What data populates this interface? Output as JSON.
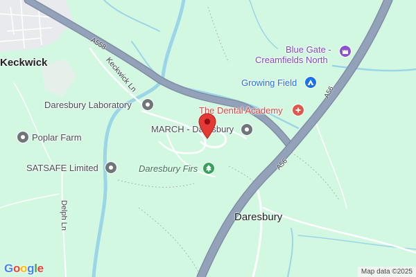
{
  "map": {
    "places": {
      "keckwick": "Keckwick",
      "daresbury": "Daresbury"
    },
    "pois": {
      "daresbury_laboratory": "Daresbury Laboratory",
      "march_daresbury": "MARCH - Daresbury",
      "poplar_farm": "Poplar Farm",
      "satsafe": "SATSAFE Limited",
      "daresbury_firs": "Daresbury Firs",
      "blue_gate_line1": "Blue Gate -",
      "blue_gate_line2": "Creamfields North",
      "growing_field": "Growing Field",
      "dental_academy": "The Dental Academy"
    },
    "roads": {
      "a558": "A558",
      "a56_north": "A56",
      "a56_south": "A56",
      "keckwick_ln": "Keckwick Ln",
      "delph_ln": "Delph Ln"
    },
    "logo": {
      "g1": "G",
      "o1": "o",
      "o2": "o",
      "g2": "g",
      "l": "l",
      "e": "e"
    },
    "attribution": "Map data ©2025",
    "colors": {
      "land": "#d3f8e2",
      "water": "#9ad5e8",
      "major_road": "#8e9bb0",
      "minor_road": "#ffffff",
      "marker": "#e53935"
    },
    "icons": {
      "marker": "red-pin-marker",
      "poi_generic": "circle-dot-icon",
      "blue_gate": "castle-icon",
      "growing_field": "tent-icon",
      "dental": "medical-cross-icon",
      "firs": "tree-icon"
    }
  }
}
